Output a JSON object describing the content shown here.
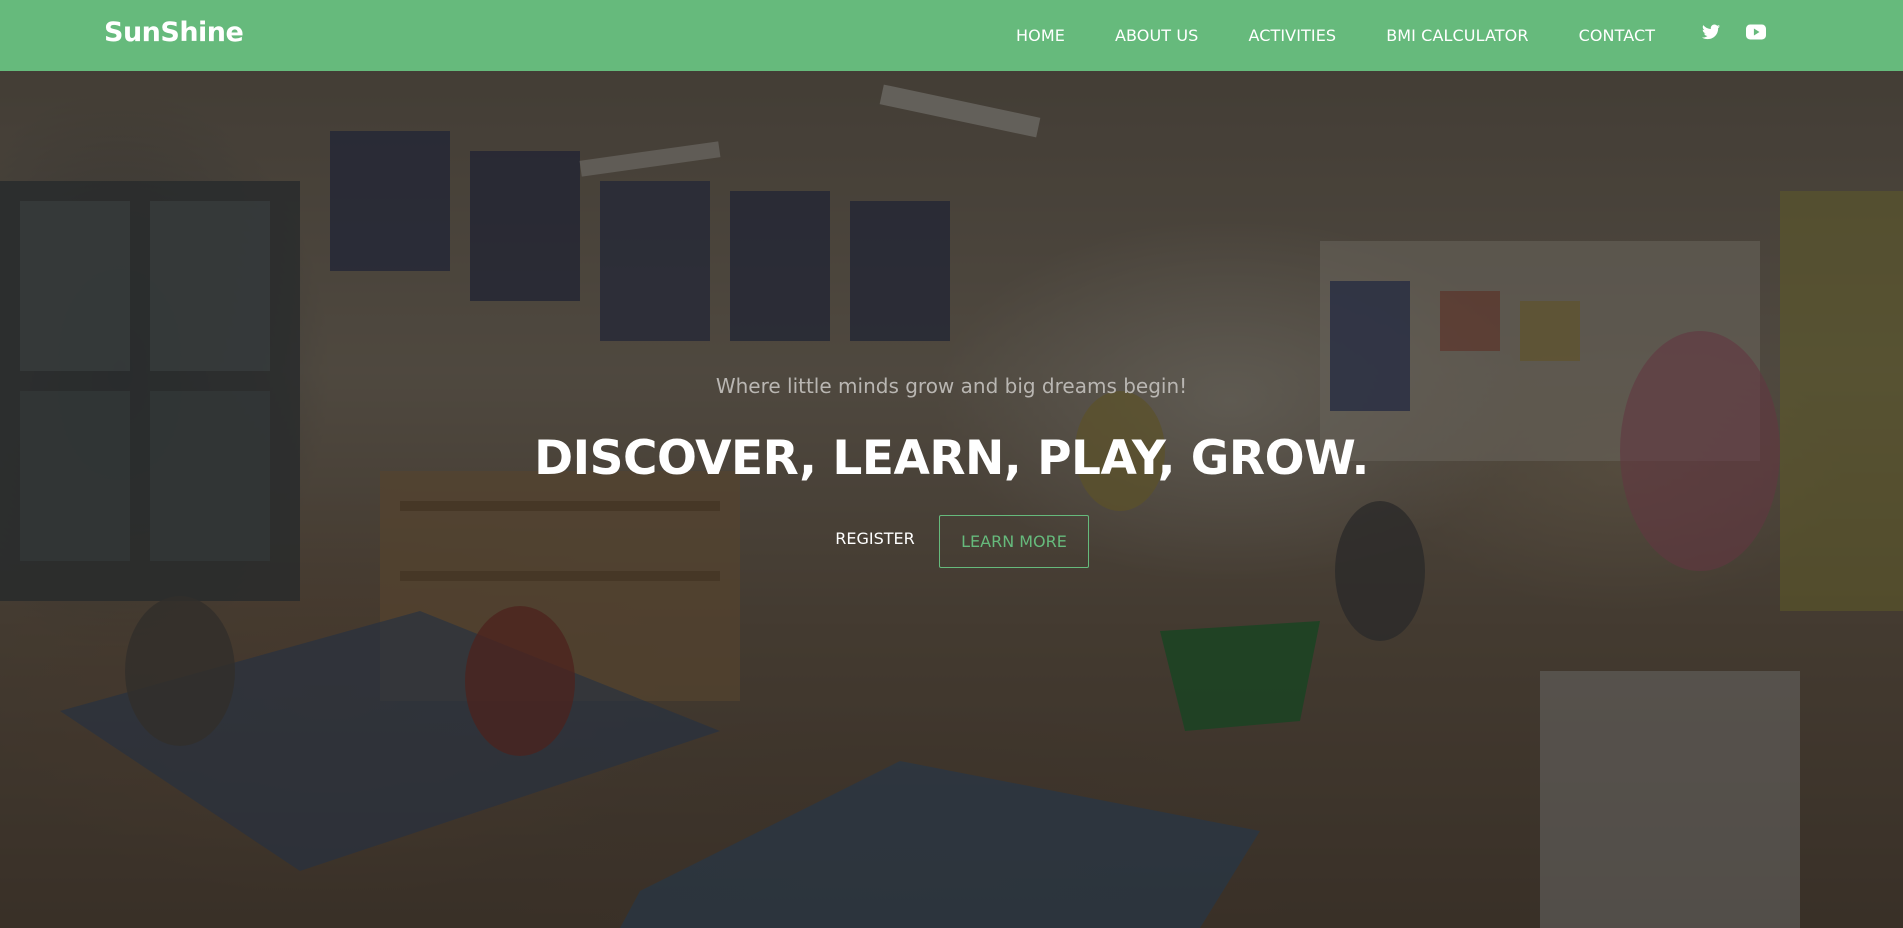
{
  "brand": {
    "name": "SunShine"
  },
  "nav": {
    "items": [
      {
        "label": "HOME"
      },
      {
        "label": "ABOUT US"
      },
      {
        "label": "ACTIVITIES"
      },
      {
        "label": "BMI CALCULATOR"
      },
      {
        "label": "CONTACT"
      }
    ],
    "social": [
      {
        "icon": "twitter-icon"
      },
      {
        "icon": "youtube-icon"
      }
    ]
  },
  "hero": {
    "tagline": "Where little minds grow and big dreams begin!",
    "headline": "DISCOVER, LEARN, PLAY, GROW.",
    "register_label": "REGISTER",
    "learn_more_label": "LEARN MORE",
    "background": "classroom-photo"
  },
  "colors": {
    "accent": "#66ba7c",
    "overlay": "#19161499",
    "text": "#ffffff"
  }
}
